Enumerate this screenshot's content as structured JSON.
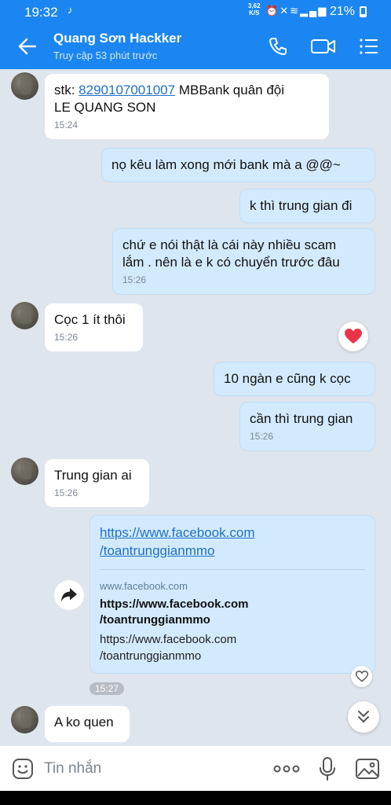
{
  "status_bar": {
    "time": "19:32",
    "notif_icon": "tiktok-icon",
    "speed_value": "3,62",
    "speed_unit": "K/S",
    "battery": "21%"
  },
  "header": {
    "name": "Quang Sơn Hackker",
    "last_seen": "Truy cập 53 phút trước"
  },
  "messages": [
    {
      "dir": "in",
      "prefix": "stk: ",
      "link": "8290107001007",
      "text": " MBBank quân đội",
      "line2": "LE QUANG SON",
      "time": "15:24"
    },
    {
      "dir": "out",
      "text": "nọ kêu làm xong mới bank mà a @@~"
    },
    {
      "dir": "out",
      "text": "k thì trung gian đi"
    },
    {
      "dir": "out",
      "text": "chứ e nói thật là cái này nhiều scam",
      "line2": "lắm . nên là e k có chuyển trước đâu",
      "time": "15:26"
    },
    {
      "dir": "in",
      "text": "Cọc 1 ít thôi",
      "time": "15:26",
      "reaction": "heart"
    },
    {
      "dir": "out",
      "text": "10 ngàn e cũng k cọc"
    },
    {
      "dir": "out",
      "text": "cần thì trung gian",
      "time": "15:26"
    },
    {
      "dir": "in",
      "text": "Trung gian ai",
      "time": "15:26"
    },
    {
      "dir": "in",
      "text": "A ko quen"
    }
  ],
  "link_card": {
    "url_line1": "https://www.facebook.com",
    "url_line2": "/toantrunggianmmo",
    "domain": "www.facebook.com",
    "title_line1": "https://www.facebook.com",
    "title_line2": "/toantrunggianmmo",
    "desc_line1": "https://www.facebook.com",
    "desc_line2": "/toantrunggianmmo",
    "time": "15:27"
  },
  "composer": {
    "placeholder": "Tin nhắn"
  },
  "colors": {
    "header": "#1b86f2",
    "chat_bg": "#dfe5ed",
    "out_bubble": "#d3eafe",
    "in_bubble": "#ffffff",
    "link": "#1d71c7",
    "heart": "#e8344a"
  }
}
